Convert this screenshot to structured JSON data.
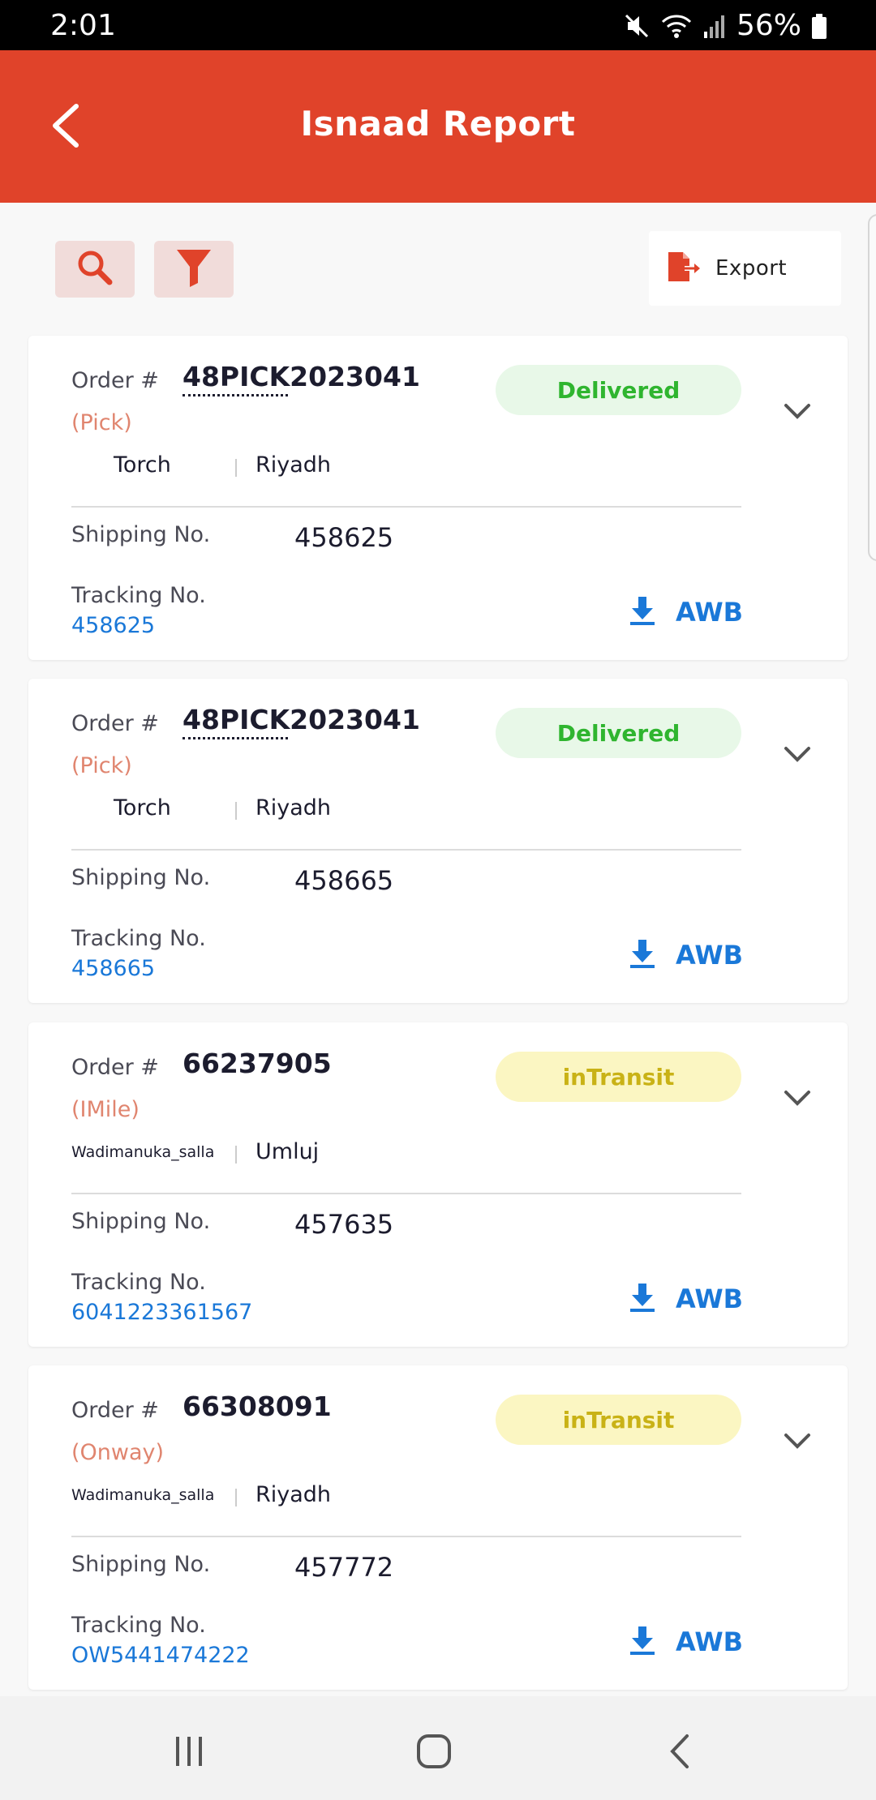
{
  "status_bar": {
    "time": "2:01",
    "battery": "56%"
  },
  "header": {
    "title": "Isnaad Report"
  },
  "toolbar": {
    "export_label": "Export"
  },
  "labels": {
    "order": "Order #",
    "shipping": "Shipping No.",
    "tracking": "Tracking No.",
    "awb": "AWB"
  },
  "colors": {
    "header": "#e0432a",
    "delivered_text": "#2fb52f",
    "delivered_bg": "#e8f8e8",
    "transit_text": "#c9b216",
    "transit_bg": "#fbf6c2",
    "link": "#1a78d8",
    "carrier": "#e0856f"
  },
  "orders": [
    {
      "order_no": "48PICK2023041",
      "carrier": "(Pick)",
      "status": "Delivered",
      "merchant": "Torch",
      "city": "Riyadh",
      "shipping_no": "458625",
      "tracking_no": "458625"
    },
    {
      "order_no": "48PICK2023041",
      "carrier": "(Pick)",
      "status": "Delivered",
      "merchant": "Torch",
      "city": "Riyadh",
      "shipping_no": "458665",
      "tracking_no": "458665"
    },
    {
      "order_no": "66237905",
      "carrier": "(IMile)",
      "status": "inTransit",
      "merchant": "Wadimanuka_salla",
      "city": "Umluj",
      "shipping_no": "457635",
      "tracking_no": "6041223361567"
    },
    {
      "order_no": "66308091",
      "carrier": "(Onway)",
      "status": "inTransit",
      "merchant": "Wadimanuka_salla",
      "city": "Riyadh",
      "shipping_no": "457772",
      "tracking_no": "OW5441474222"
    }
  ]
}
